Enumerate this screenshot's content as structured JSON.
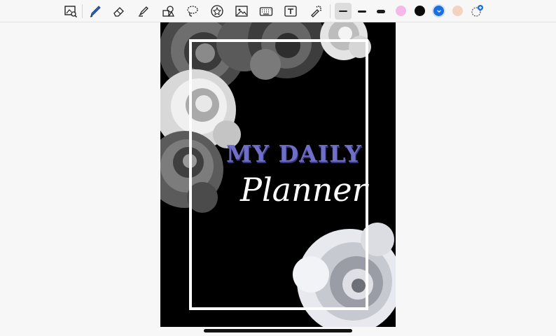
{
  "toolbar": {
    "tools": [
      {
        "name": "image-search-tool",
        "icon": "image-magnifier-icon"
      },
      {
        "name": "pen-tool",
        "icon": "pen-icon",
        "active": true
      },
      {
        "name": "eraser-tool",
        "icon": "eraser-icon"
      },
      {
        "name": "highlighter-tool",
        "icon": "highlighter-icon"
      },
      {
        "name": "shapes-tool",
        "icon": "shapes-icon"
      },
      {
        "name": "lasso-tool",
        "icon": "lasso-icon"
      },
      {
        "name": "sticker-tool",
        "icon": "star-sticker-icon"
      },
      {
        "name": "image-tool",
        "icon": "image-icon"
      },
      {
        "name": "keyboard-tool",
        "icon": "keyboard-icon"
      },
      {
        "name": "text-tool",
        "icon": "text-box-icon"
      },
      {
        "name": "laser-tool",
        "icon": "laser-pointer-icon"
      }
    ],
    "stroke_sizes": [
      "thin",
      "medium",
      "thick"
    ],
    "colors": [
      "#f6b8e6",
      "#0b0b0b",
      "#1c6fe0",
      "#f2d2c0"
    ],
    "selected_color": "#1c6fe0"
  },
  "page": {
    "title_line1": "MY DAILY",
    "title_line2": "Planner",
    "title_color": "#6f6ec9"
  }
}
